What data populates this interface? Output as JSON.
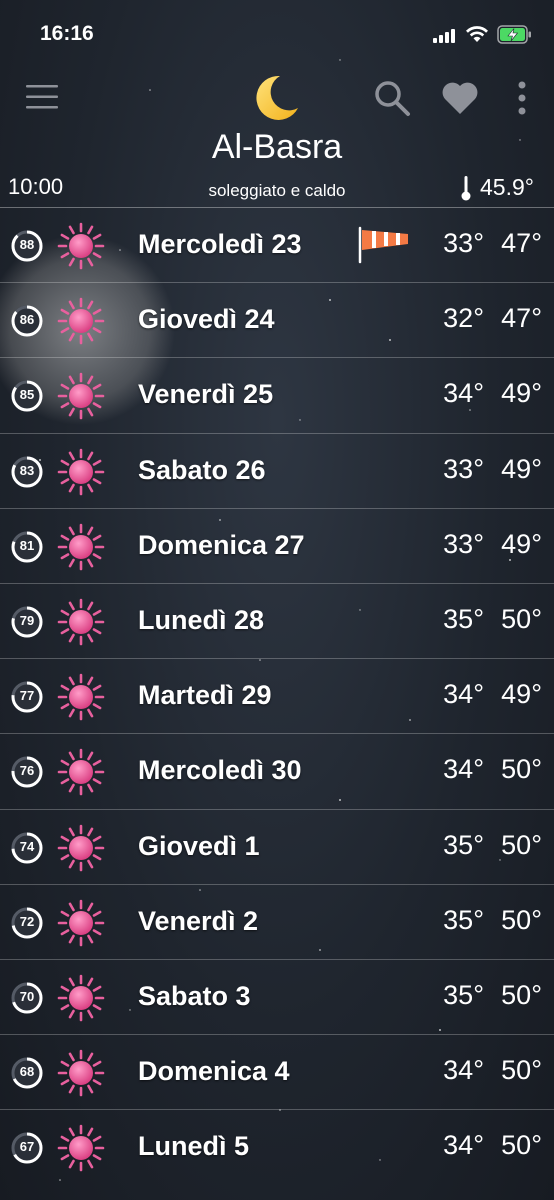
{
  "status_bar": {
    "time": "16:16"
  },
  "header": {
    "icons": [
      "menu-icon",
      "moon-icon",
      "search-icon",
      "heart-icon",
      "more-icon"
    ],
    "city": "Al-Basra",
    "local_time": "10:00",
    "condition": "soleggiato e caldo",
    "current_temp": "45.9°"
  },
  "colors": {
    "sun": "#e8609e",
    "background": "#1f252e",
    "windsock": "#f47a45"
  },
  "forecast": [
    {
      "badge": "88",
      "badge_level": 0.88,
      "day": "Mercoledì 23",
      "min": "33°",
      "max": "47°",
      "icon": "sun-icon",
      "windsock": true
    },
    {
      "badge": "86",
      "badge_level": 0.86,
      "day": "Giovedì 24",
      "min": "32°",
      "max": "47°",
      "icon": "sun-icon"
    },
    {
      "badge": "85",
      "badge_level": 0.85,
      "day": "Venerdì 25",
      "min": "34°",
      "max": "49°",
      "icon": "sun-icon"
    },
    {
      "badge": "83",
      "badge_level": 0.83,
      "day": "Sabato 26",
      "min": "33°",
      "max": "49°",
      "icon": "sun-icon"
    },
    {
      "badge": "81",
      "badge_level": 0.81,
      "day": "Domenica 27",
      "min": "33°",
      "max": "49°",
      "icon": "sun-icon"
    },
    {
      "badge": "79",
      "badge_level": 0.79,
      "day": "Lunedì 28",
      "min": "35°",
      "max": "50°",
      "icon": "sun-icon"
    },
    {
      "badge": "77",
      "badge_level": 0.77,
      "day": "Martedì 29",
      "min": "34°",
      "max": "49°",
      "icon": "sun-icon"
    },
    {
      "badge": "76",
      "badge_level": 0.76,
      "day": "Mercoledì 30",
      "min": "34°",
      "max": "50°",
      "icon": "sun-icon"
    },
    {
      "badge": "74",
      "badge_level": 0.74,
      "day": "Giovedì 1",
      "min": "35°",
      "max": "50°",
      "icon": "sun-icon"
    },
    {
      "badge": "72",
      "badge_level": 0.72,
      "day": "Venerdì 2",
      "min": "35°",
      "max": "50°",
      "icon": "sun-icon"
    },
    {
      "badge": "70",
      "badge_level": 0.7,
      "day": "Sabato 3",
      "min": "35°",
      "max": "50°",
      "icon": "sun-icon"
    },
    {
      "badge": "68",
      "badge_level": 0.68,
      "day": "Domenica 4",
      "min": "34°",
      "max": "50°",
      "icon": "sun-icon"
    },
    {
      "badge": "67",
      "badge_level": 0.67,
      "day": "Lunedì 5",
      "min": "34°",
      "max": "50°",
      "icon": "sun-icon"
    }
  ]
}
